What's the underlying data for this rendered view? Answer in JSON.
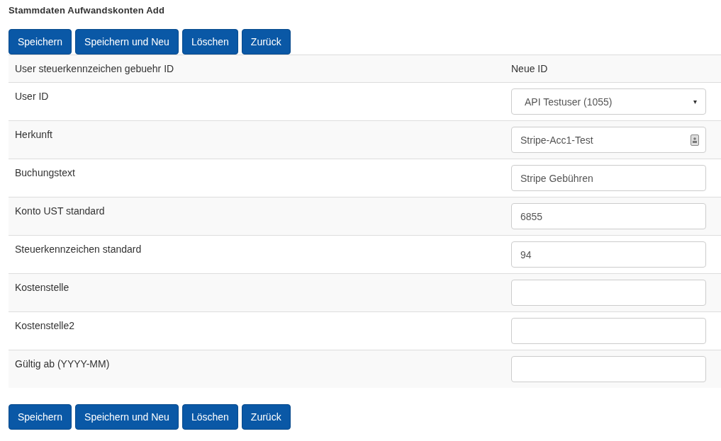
{
  "title": "Stammdaten Aufwandskonten Add",
  "buttons_top": [
    "Speichern",
    "Speichern und Neu",
    "Löschen",
    "Zurück"
  ],
  "rows": [
    {
      "kind": "static",
      "label": "User steuerkennzeichen gebuehr ID",
      "value": "Neue ID"
    },
    {
      "kind": "select",
      "label": "User ID",
      "value": "API Testuser (1055)",
      "caret": "▾"
    },
    {
      "kind": "contact",
      "label": "Herkunft",
      "value": "Stripe-Acc1-Test"
    },
    {
      "kind": "text",
      "label": "Buchungstext",
      "value": "Stripe Gebühren"
    },
    {
      "kind": "text",
      "label": "Konto UST standard",
      "value": "6855"
    },
    {
      "kind": "text",
      "label": "Steuerkennzeichen standard",
      "value": "94"
    },
    {
      "kind": "text",
      "label": "Kostenstelle"
    },
    {
      "kind": "text",
      "label": "Kostenstelle2"
    },
    {
      "kind": "text",
      "label": "Gültig ab (YYYY-MM)"
    }
  ],
  "buttons_bottom": [
    "Speichern",
    "Speichern und Neu",
    "Löschen",
    "Zurück"
  ]
}
